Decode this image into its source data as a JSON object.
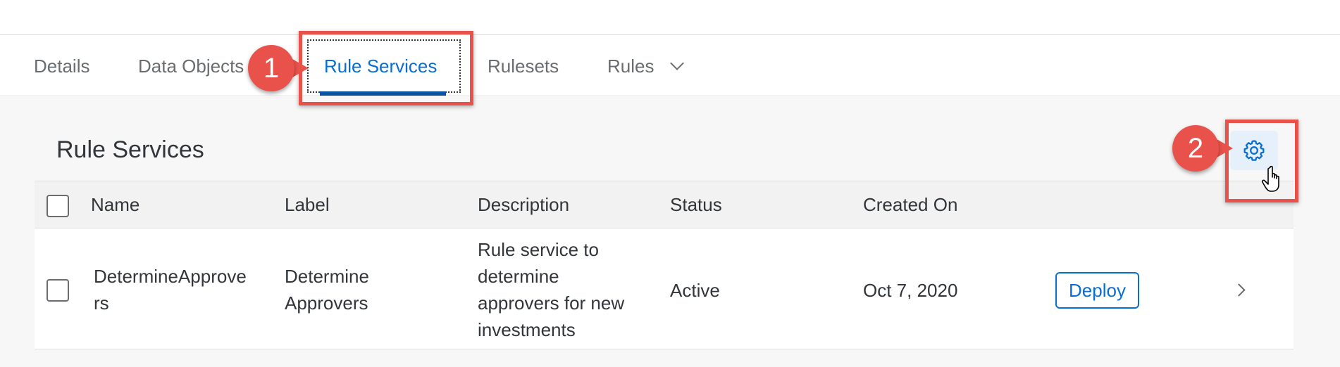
{
  "tabs": [
    {
      "label": "Details",
      "active": false
    },
    {
      "label": "Data Objects",
      "active": false
    },
    {
      "label": "Rule Services",
      "active": true
    },
    {
      "label": "Rulesets",
      "active": false
    },
    {
      "label": "Rules",
      "active": false,
      "has_dropdown": true
    }
  ],
  "section": {
    "title": "Rule Services"
  },
  "table": {
    "columns": [
      "Name",
      "Label",
      "Description",
      "Status",
      "Created On"
    ],
    "rows": [
      {
        "name": "DetermineApprovers",
        "name_lines": [
          "DetermineApprove",
          "rs"
        ],
        "label_lines": [
          "Determine",
          "Approvers"
        ],
        "description_lines": [
          "Rule service to",
          "determine",
          "approvers for new",
          "investments"
        ],
        "status": "Active",
        "created_on": "Oct 7, 2020",
        "action_label": "Deploy"
      }
    ]
  },
  "toolbar": {
    "settings_icon": "gear-icon"
  },
  "callouts": [
    {
      "number": "1",
      "target": "tab-rule-services"
    },
    {
      "number": "2",
      "target": "settings-button"
    }
  ],
  "colors": {
    "accent": "#0a6ed1",
    "active_underline": "#0854a0",
    "callout": "#e9524a",
    "background": "#f7f7f7"
  }
}
